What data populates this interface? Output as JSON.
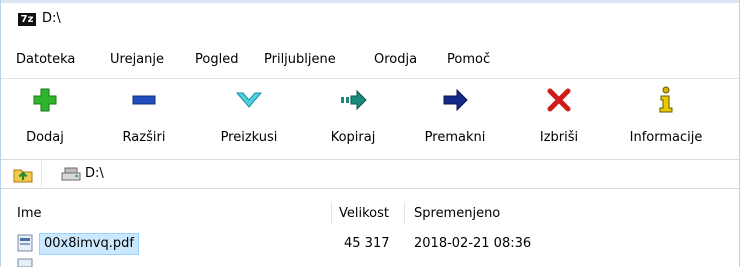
{
  "window": {
    "title": "D:\\",
    "app_icon_text": "7z"
  },
  "menu": [
    "Datoteka",
    "Urejanje",
    "Pogled",
    "Priljubljene",
    "Orodja",
    "Pomoč"
  ],
  "toolbar": [
    {
      "label": "Dodaj",
      "icon": "add-icon",
      "color": "#2db52d"
    },
    {
      "label": "Razširi",
      "icon": "extract-icon",
      "color": "#1f4fbf"
    },
    {
      "label": "Preizkusi",
      "icon": "test-icon",
      "color": "#23b6c8"
    },
    {
      "label": "Kopiraj",
      "icon": "copy-icon",
      "color": "#1c8a7a"
    },
    {
      "label": "Premakni",
      "icon": "move-icon",
      "color": "#132a8a"
    },
    {
      "label": "Izbriši",
      "icon": "delete-icon",
      "color": "#d11a1a"
    },
    {
      "label": "Informacije",
      "icon": "info-icon",
      "color": "#c9a400"
    }
  ],
  "address": {
    "path": "D:\\"
  },
  "columns": [
    "Ime",
    "Velikost",
    "Spremenjeno"
  ],
  "files": [
    {
      "name": "00x8imvq.pdf",
      "size": "45 317",
      "modified": "2018-02-21 08:36",
      "selected": true
    }
  ]
}
